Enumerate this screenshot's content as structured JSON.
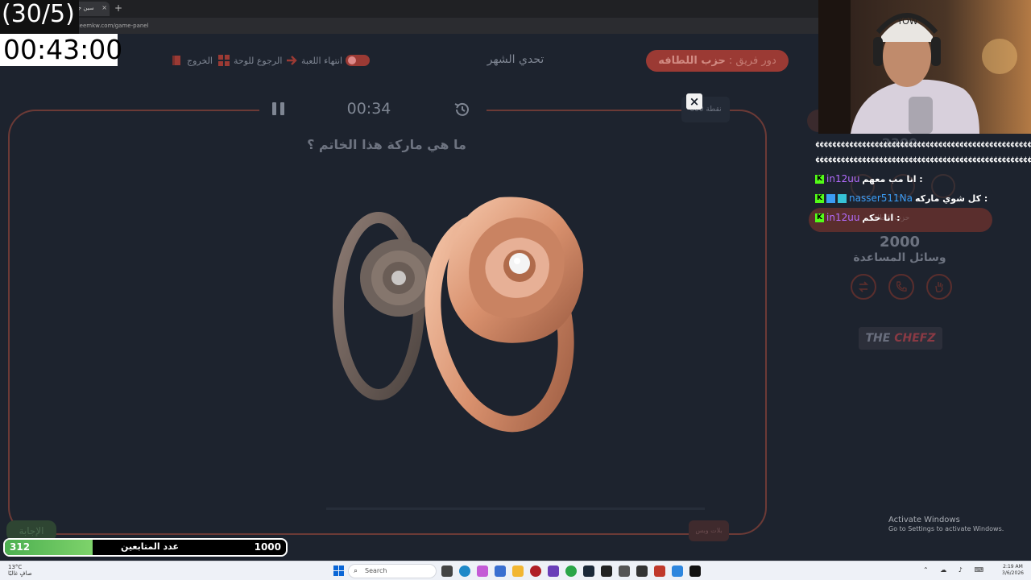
{
  "browser": {
    "tab_title": "سين جيم",
    "tab_close": "×",
    "new_tab": "+",
    "url": "seenjeemkw.com/game-panel"
  },
  "overlay": {
    "counter": "(30/5)",
    "clock": "00:43:00"
  },
  "header": {
    "team_label": "دور فريق :",
    "team_name": "حزب اللطافه",
    "challenge_title": "تحدي الشهر",
    "end_game": "انتهاء اللعبة",
    "back_to_board": "الرجوع للوحة",
    "exit": "الخروج"
  },
  "question_panel": {
    "timer": "00:34",
    "question": "ما هي ماركة هذا الخاتم ؟",
    "points_badge": "600 نقطة",
    "close_label": "×",
    "answer_button": "الإجابة",
    "stop_button": "بلات وبس"
  },
  "side_panel": {
    "score_hidden": "2300",
    "team_ghost": "حزب اللطافه",
    "score": "2000",
    "helpers_label": "وسائل المساعدة",
    "logo_a": "THE ",
    "logo_b": "CHEFZ"
  },
  "chat": {
    "separator": "¢¢¢¢¢¢¢¢¢¢¢¢¢¢¢¢¢¢¢¢¢¢¢¢¢¢¢¢¢¢¢¢¢¢¢¢¢¢¢¢¢¢¢¢¢¢¢¢¢¢¢¢¢¢",
    "messages": [
      {
        "user": "in12uu",
        "user_color": "#b46cff",
        "text": ": انا مب معهم"
      },
      {
        "user": "nasser511Na",
        "user_color": "#3b9cf5",
        "text": ": كل شوي ماركه"
      },
      {
        "user": "in12uu",
        "user_color": "#b46cff",
        "text": ": انا حكم"
      }
    ]
  },
  "followers": {
    "current": "312",
    "label": "عدد المتابعين",
    "goal": "1000",
    "progress": 0.312
  },
  "windows": {
    "activate_title": "Activate Windows",
    "activate_sub": "Go to Settings to activate Windows.",
    "weather_temp": "13°C",
    "weather_desc": "صافٍ غالبًا",
    "search": "Search",
    "time": "2:19 AM",
    "date": "3/6/2026"
  },
  "colors": {
    "board_border": "#6c3a36",
    "accent_red": "#9b3a34",
    "background": "#1d232e"
  }
}
